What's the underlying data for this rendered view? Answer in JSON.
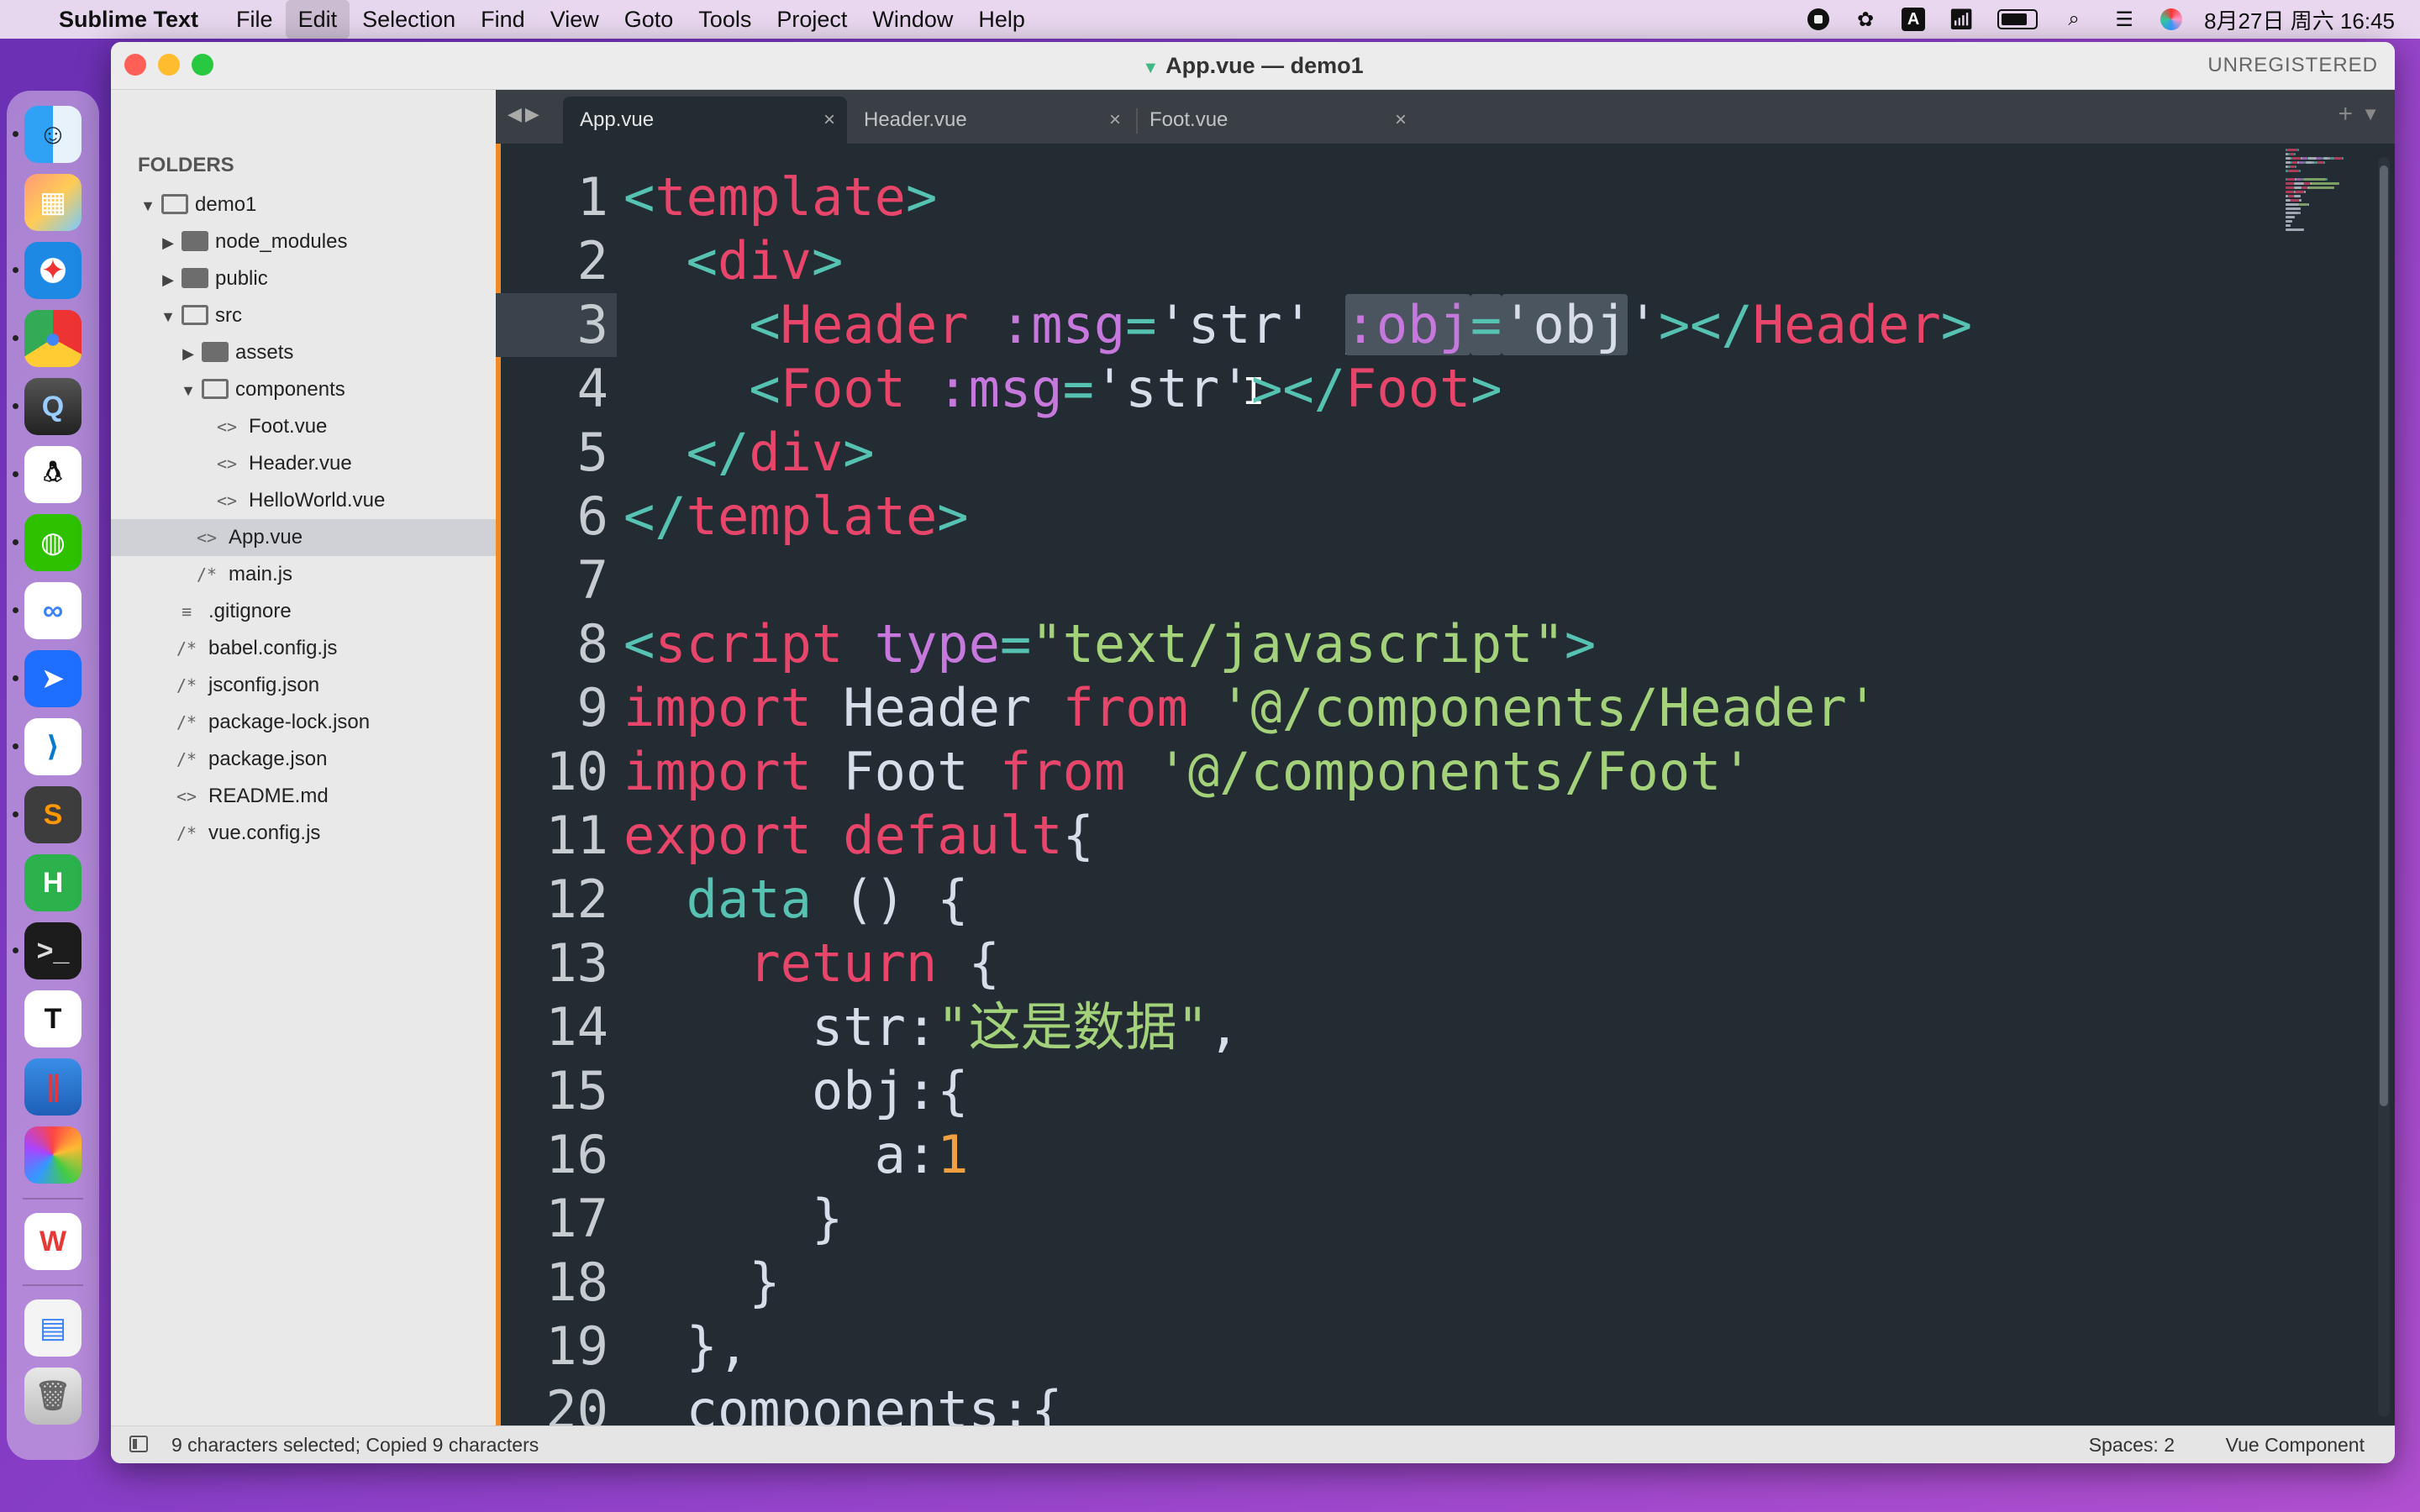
{
  "menubar": {
    "app_name": "Sublime Text",
    "menus": [
      "File",
      "Edit",
      "Selection",
      "Find",
      "View",
      "Goto",
      "Tools",
      "Project",
      "Window",
      "Help"
    ],
    "active_menu": "Edit",
    "input_indicator": "A",
    "clock": "8月27日 周六  16:45"
  },
  "window": {
    "title": "App.vue — demo1",
    "unregistered": "UNREGISTERED"
  },
  "sidebar": {
    "header": "FOLDERS",
    "items": [
      {
        "label": "demo1",
        "kind": "folder-open",
        "depth": 0
      },
      {
        "label": "node_modules",
        "kind": "folder",
        "depth": 1
      },
      {
        "label": "public",
        "kind": "folder",
        "depth": 1
      },
      {
        "label": "src",
        "kind": "folder-open",
        "depth": 1
      },
      {
        "label": "assets",
        "kind": "folder",
        "depth": 2
      },
      {
        "label": "components",
        "kind": "folder-open",
        "depth": 2
      },
      {
        "label": "Foot.vue",
        "kind": "vue",
        "depth": 3
      },
      {
        "label": "Header.vue",
        "kind": "vue",
        "depth": 3
      },
      {
        "label": "HelloWorld.vue",
        "kind": "vue",
        "depth": 3
      },
      {
        "label": "App.vue",
        "kind": "vue",
        "depth": 2,
        "selected": true
      },
      {
        "label": "main.js",
        "kind": "js",
        "depth": 2
      },
      {
        "label": ".gitignore",
        "kind": "txt",
        "depth": 1
      },
      {
        "label": "babel.config.js",
        "kind": "js",
        "depth": 1
      },
      {
        "label": "jsconfig.json",
        "kind": "js",
        "depth": 1
      },
      {
        "label": "package-lock.json",
        "kind": "js",
        "depth": 1
      },
      {
        "label": "package.json",
        "kind": "js",
        "depth": 1
      },
      {
        "label": "README.md",
        "kind": "vue",
        "depth": 1
      },
      {
        "label": "vue.config.js",
        "kind": "js",
        "depth": 1
      }
    ]
  },
  "tabs": [
    {
      "label": "App.vue",
      "active": true
    },
    {
      "label": "Header.vue",
      "active": false
    },
    {
      "label": "Foot.vue",
      "active": false
    }
  ],
  "editor": {
    "current_line": 3,
    "lines": [
      [
        [
          "t-br",
          "<"
        ],
        [
          "t-tag",
          "template"
        ],
        [
          "t-br",
          ">"
        ]
      ],
      [
        [
          "t-plain",
          "  "
        ],
        [
          "t-br",
          "<"
        ],
        [
          "t-tag",
          "div"
        ],
        [
          "t-br",
          ">"
        ]
      ],
      [
        [
          "t-plain",
          "    "
        ],
        [
          "t-br",
          "<"
        ],
        [
          "t-tag",
          "Header"
        ],
        [
          "t-plain",
          " "
        ],
        [
          "t-attr",
          ":msg"
        ],
        [
          "t-br",
          "="
        ],
        [
          "t-plain",
          "'str' "
        ],
        [
          "caret",
          ""
        ],
        [
          "t-sel t-attr",
          ":obj"
        ],
        [
          "t-sel t-br",
          "="
        ],
        [
          "t-sel t-plain",
          "'obj"
        ],
        [
          "t-plain",
          "'"
        ],
        [
          "t-br",
          "></"
        ],
        [
          "t-tag",
          "Header"
        ],
        [
          "t-br",
          ">"
        ]
      ],
      [
        [
          "t-plain",
          "    "
        ],
        [
          "t-br",
          "<"
        ],
        [
          "t-tag",
          "Foot"
        ],
        [
          "t-plain",
          " "
        ],
        [
          "t-attr",
          ":msg"
        ],
        [
          "t-br",
          "="
        ],
        [
          "t-plain",
          "'str'"
        ],
        [
          "ibeam",
          "I"
        ],
        [
          "t-br",
          "></"
        ],
        [
          "t-tag",
          "Foot"
        ],
        [
          "t-br",
          ">"
        ]
      ],
      [
        [
          "t-plain",
          "  "
        ],
        [
          "t-br",
          "</"
        ],
        [
          "t-tag",
          "div"
        ],
        [
          "t-br",
          ">"
        ]
      ],
      [
        [
          "t-br",
          "</"
        ],
        [
          "t-tag",
          "template"
        ],
        [
          "t-br",
          ">"
        ]
      ],
      [],
      [
        [
          "t-br",
          "<"
        ],
        [
          "t-tag",
          "script"
        ],
        [
          "t-plain",
          " "
        ],
        [
          "t-attr",
          "type"
        ],
        [
          "t-br",
          "="
        ],
        [
          "t-str",
          "\"text/javascript\""
        ],
        [
          "t-br",
          ">"
        ]
      ],
      [
        [
          "t-kw",
          "import"
        ],
        [
          "t-plain",
          " Header "
        ],
        [
          "t-kw",
          "from"
        ],
        [
          "t-plain",
          " "
        ],
        [
          "t-str",
          "'@/components/Header'"
        ]
      ],
      [
        [
          "t-kw",
          "import"
        ],
        [
          "t-plain",
          " Foot "
        ],
        [
          "t-kw",
          "from"
        ],
        [
          "t-plain",
          " "
        ],
        [
          "t-str",
          "'@/components/Foot'"
        ]
      ],
      [
        [
          "t-kw",
          "export"
        ],
        [
          "t-plain",
          " "
        ],
        [
          "t-kw",
          "default"
        ],
        [
          "t-plain",
          "{"
        ]
      ],
      [
        [
          "t-plain",
          "  "
        ],
        [
          "t-kw2",
          "data"
        ],
        [
          "t-plain",
          " () {"
        ]
      ],
      [
        [
          "t-plain",
          "    "
        ],
        [
          "t-kw",
          "return"
        ],
        [
          "t-plain",
          " {"
        ]
      ],
      [
        [
          "t-plain",
          "      str:"
        ],
        [
          "t-str",
          "\"这是数据\""
        ],
        [
          "t-plain",
          ","
        ]
      ],
      [
        [
          "t-plain",
          "      obj:{"
        ]
      ],
      [
        [
          "t-plain",
          "        a:"
        ],
        [
          "t-num",
          "1"
        ]
      ],
      [
        [
          "t-plain",
          "      }"
        ]
      ],
      [
        [
          "t-plain",
          "    }"
        ]
      ],
      [
        [
          "t-plain",
          "  },"
        ]
      ],
      [
        [
          "t-plain",
          "  components:{"
        ]
      ]
    ]
  },
  "statusbar": {
    "text": "9 characters selected; Copied 9 characters",
    "spaces": "Spaces: 2",
    "syntax": "Vue Component"
  },
  "dock": {
    "icons": [
      "finder-icon",
      "launchpad-icon",
      "safari-icon",
      "chrome-icon",
      "quicktime-icon",
      "qq-icon",
      "wechat-icon",
      "baidunetdisk-icon",
      "feishu-icon",
      "vscode-icon",
      "sublime-icon",
      "hbuilder-icon",
      "terminal-icon",
      "typora-icon",
      "parallels-icon",
      "colorpicker-icon",
      "wps-icon",
      "downloads-stack-icon",
      "trash-icon"
    ]
  }
}
